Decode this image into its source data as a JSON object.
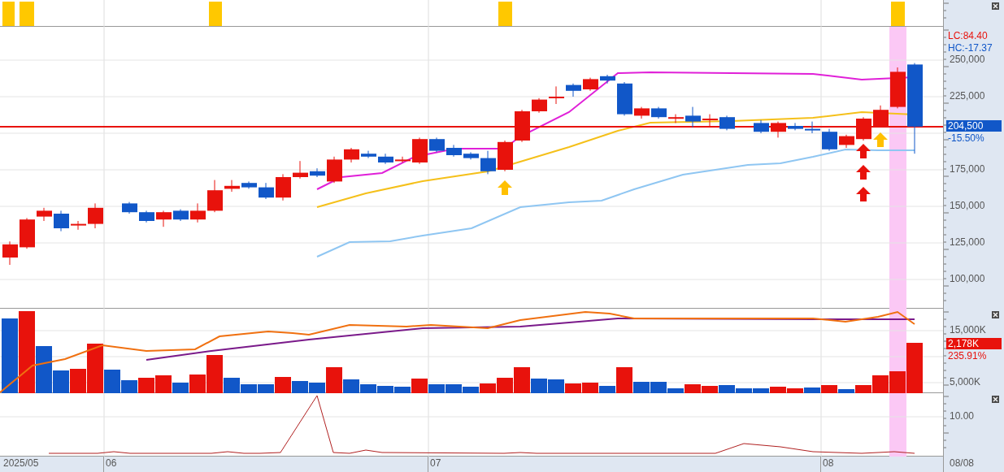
{
  "price_panel": {
    "y_axis_labels": [
      "250,000",
      "225,000",
      "175,000",
      "150,000",
      "125,000",
      "100,000"
    ],
    "readouts": [
      {
        "kind": "lc",
        "text": "LC:84.40"
      },
      {
        "kind": "hc",
        "text": "HC:-17.37"
      },
      {
        "kind": "price_tag",
        "text": "204,500"
      },
      {
        "kind": "change",
        "text": "-15.50%"
      }
    ]
  },
  "volume_panel": {
    "y_axis_labels": [
      "15,000K",
      "5,000K"
    ],
    "readouts": [
      {
        "kind": "volume_tag",
        "text": "2,178K"
      },
      {
        "kind": "volume_change",
        "text": "235.91%"
      }
    ]
  },
  "indicator_panel": {
    "y_axis_labels": [
      "10.00"
    ]
  },
  "date_axis": {
    "labels": [
      "2025/05",
      "06",
      "07",
      "08"
    ],
    "current_date": "08/08"
  }
}
